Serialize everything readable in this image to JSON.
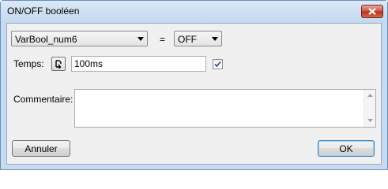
{
  "window": {
    "title": "ON/OFF booléen"
  },
  "condition": {
    "variable": "VarBool_num6",
    "operator": "=",
    "value": "OFF"
  },
  "temps": {
    "label": "Temps:",
    "value": "100ms",
    "enabled": true
  },
  "comment": {
    "label": "Commentaire:",
    "value": ""
  },
  "buttons": {
    "cancel": "Annuler",
    "ok": "OK"
  },
  "icons": {
    "close": "close-icon",
    "refresh": "refresh-icon",
    "check": "check-icon",
    "dropdown": "chevron-down-icon",
    "scroll_up": "scroll-up-icon",
    "scroll_down": "scroll-down-icon"
  },
  "colors": {
    "title_bar": "#c4d8ef",
    "client_bg": "#f0f0f0",
    "close_button": "#c85040",
    "default_button_border": "#3c7fb1"
  }
}
